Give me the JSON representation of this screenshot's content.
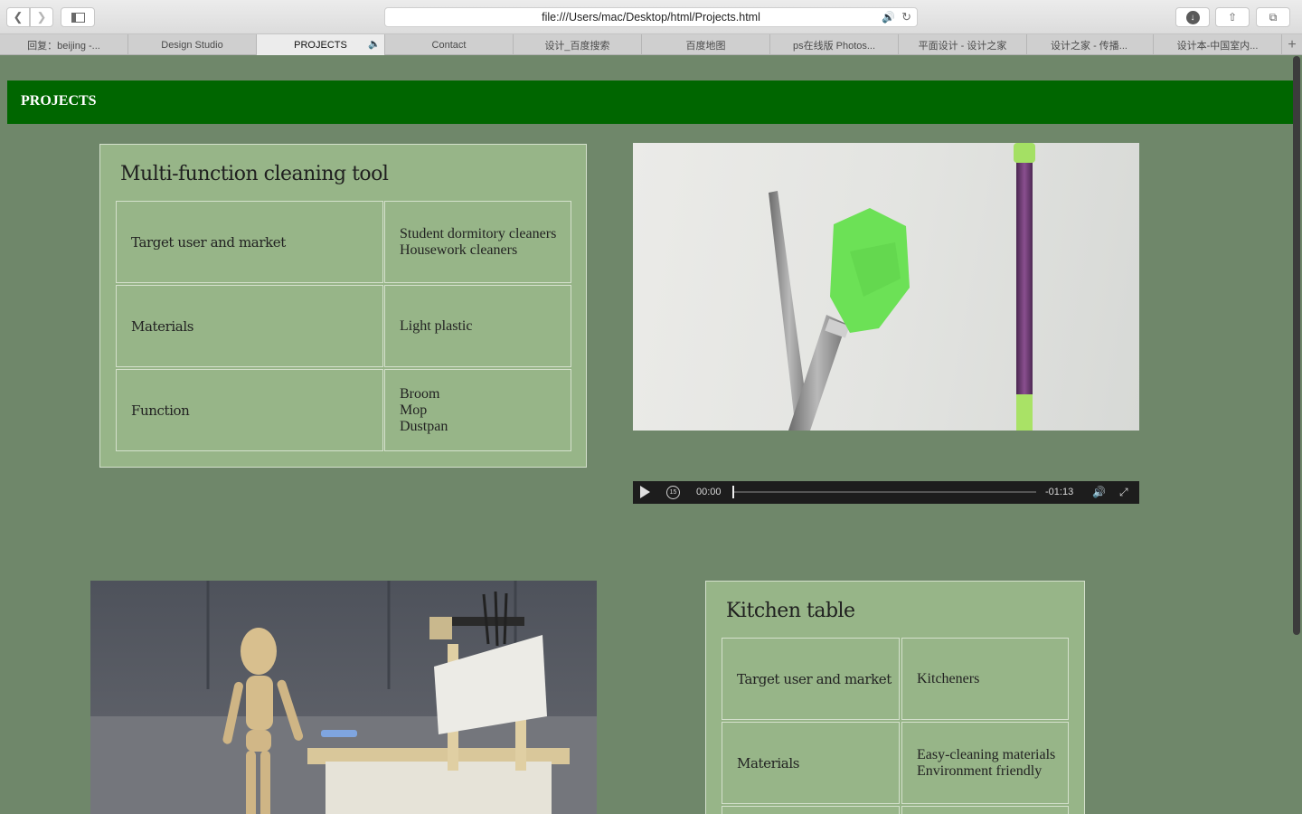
{
  "browser": {
    "url": "file:///Users/mac/Desktop/html/Projects.html",
    "tabs": [
      {
        "label": "回复：beijing -...",
        "active": false
      },
      {
        "label": "Design Studio",
        "active": false
      },
      {
        "label": "PROJECTS",
        "active": true,
        "audio": true
      },
      {
        "label": "Contact",
        "active": false
      },
      {
        "label": "设计_百度搜索",
        "active": false
      },
      {
        "label": "百度地图",
        "active": false
      },
      {
        "label": "ps在线版 Photos...",
        "active": false
      },
      {
        "label": "平面设计 - 设计之家",
        "active": false
      },
      {
        "label": "设计之家 - 传播...",
        "active": false
      },
      {
        "label": "设计本-中国室内...",
        "active": false
      }
    ],
    "icons": {
      "back": "chevron-left-icon",
      "forward": "chevron-right-icon",
      "sidebar": "sidebar-icon",
      "sound": "speaker-icon",
      "reload": "reload-icon",
      "download": "download-icon",
      "share": "share-icon",
      "tabs": "tab-overview-icon",
      "new_tab": "plus-icon"
    }
  },
  "page": {
    "title": "PROJECTS",
    "colors": {
      "header": "#006600",
      "background": "#6f876a",
      "card": "#97b588"
    }
  },
  "project1": {
    "title": "Multi-function cleaning tool",
    "rows": [
      {
        "key": "Target user and market",
        "values": [
          "Student dormitory cleaners",
          "Housework cleaners"
        ]
      },
      {
        "key": "Materials",
        "values": [
          "Light plastic"
        ]
      },
      {
        "key": "Function",
        "values": [
          "Broom",
          "Mop",
          "Dustpan"
        ]
      }
    ]
  },
  "video": {
    "current_time": "00:00",
    "remaining_time": "-01:13",
    "progress": 0,
    "replay_label": "15"
  },
  "project2": {
    "title": "Kitchen table",
    "rows": [
      {
        "key": "Target user and market",
        "values": [
          "Kitcheners"
        ]
      },
      {
        "key": "Materials",
        "values": [
          "Easy-cleaning materials",
          "Environment friendly"
        ]
      }
    ]
  }
}
